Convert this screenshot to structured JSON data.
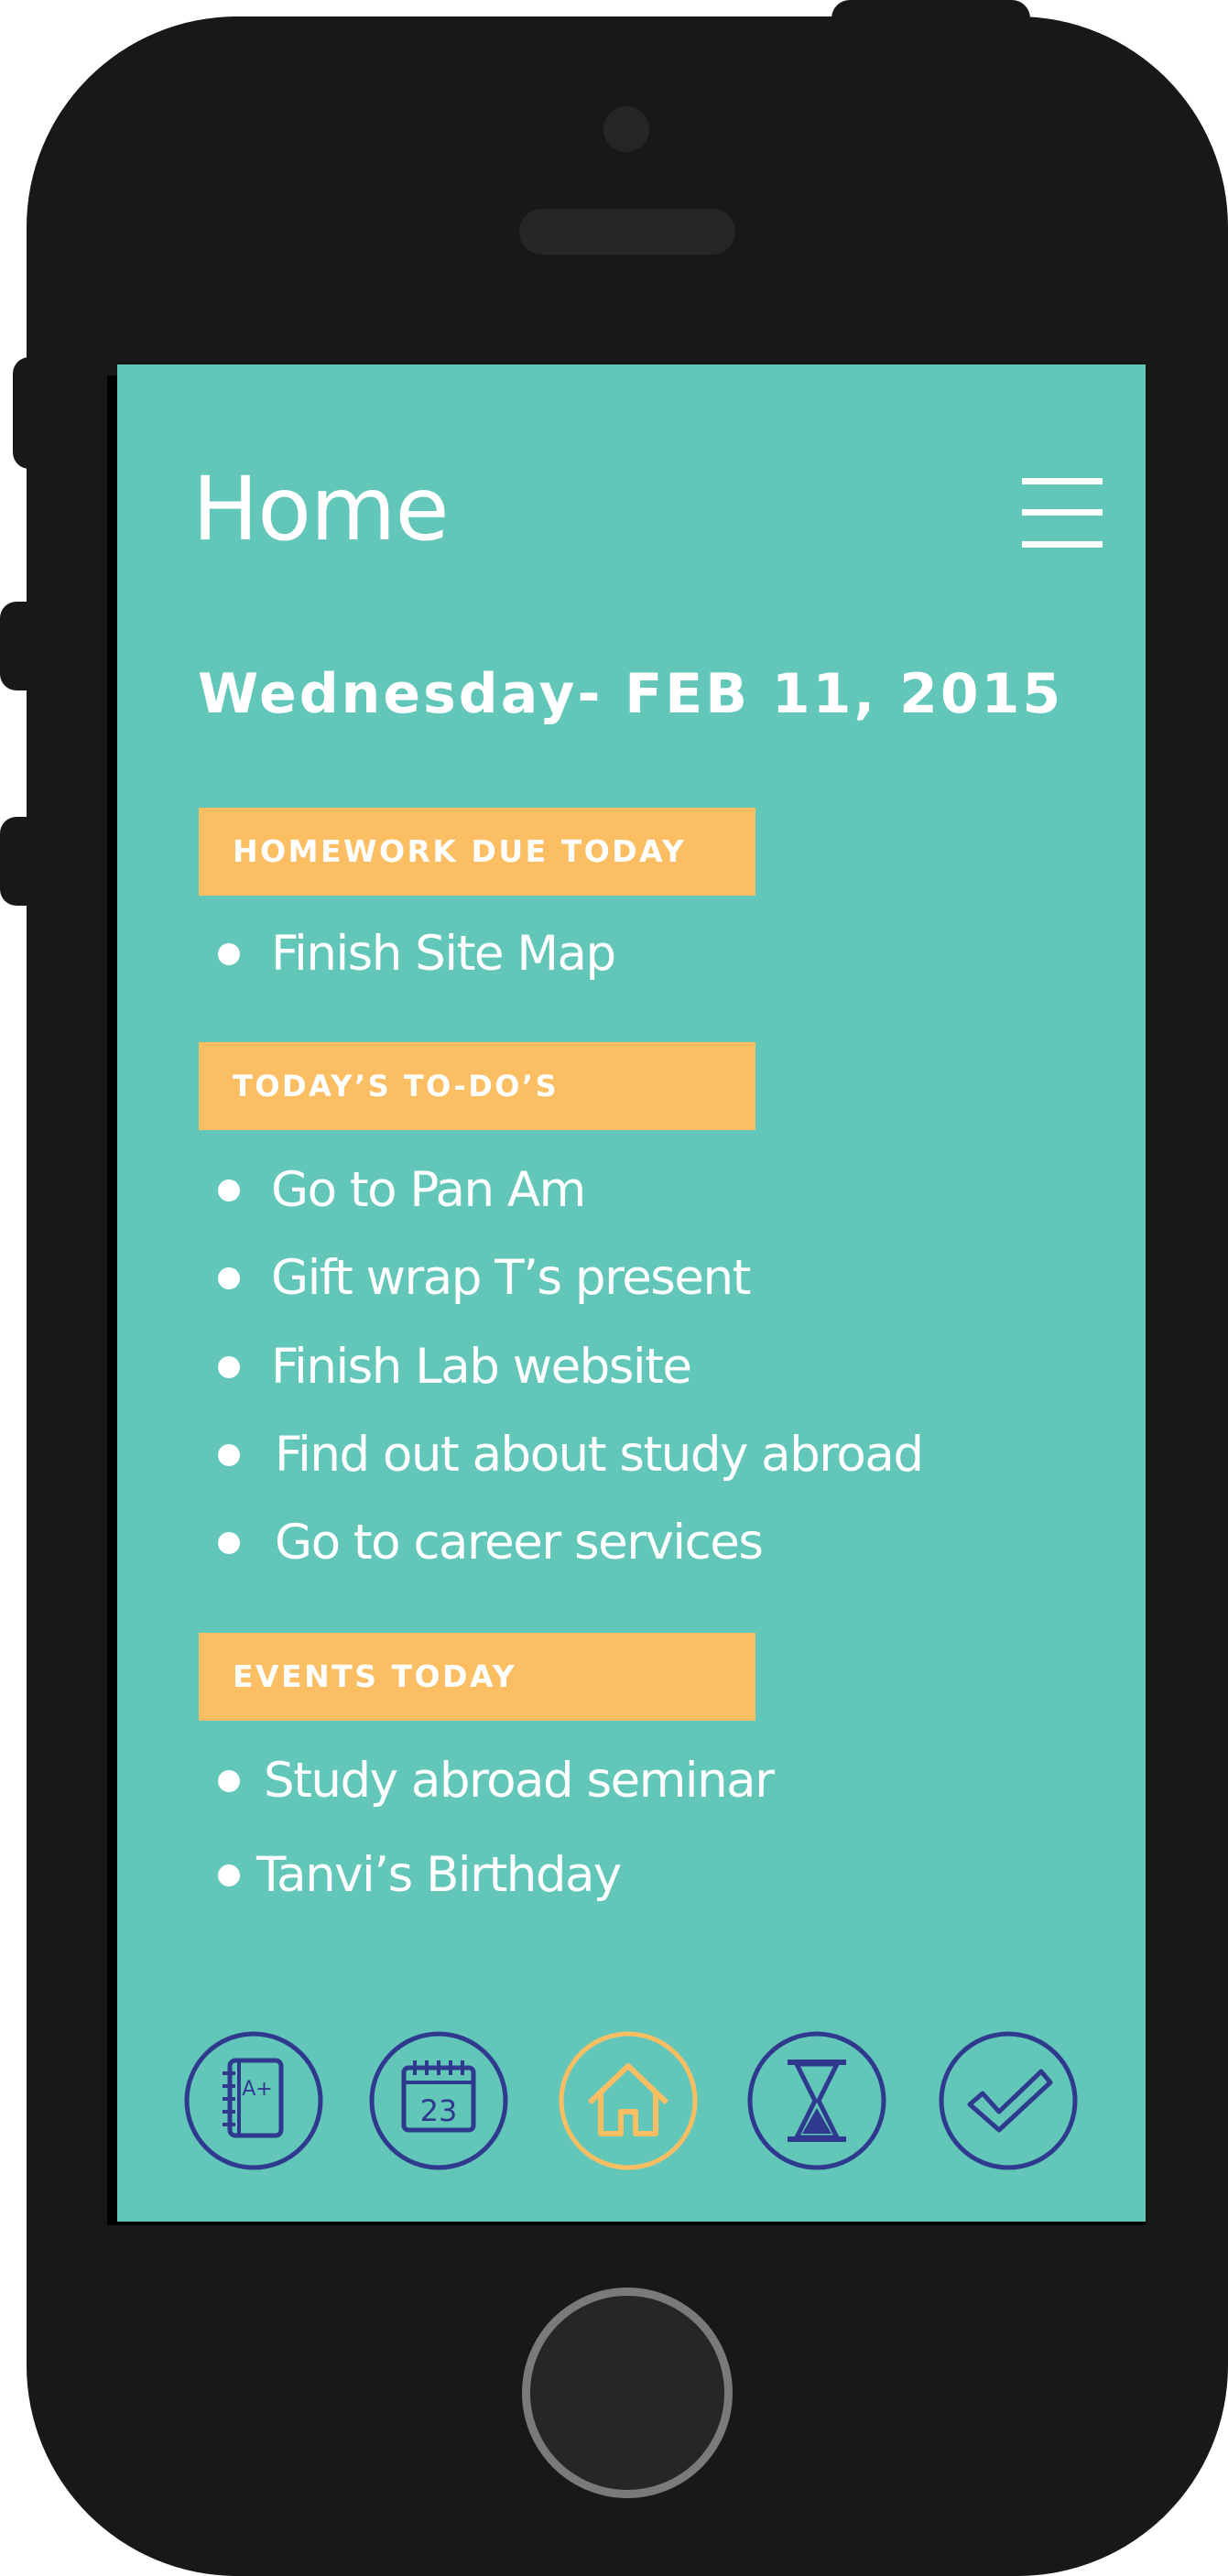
{
  "header": {
    "title": "Home",
    "menu_icon": "hamburger-icon"
  },
  "date": "Wednesday- FEB 11, 2015",
  "sections": [
    {
      "label": "HOMEWORK DUE TODAY",
      "items": [
        "Finish Site Map"
      ]
    },
    {
      "label": "TODAY’S TO-DO’S",
      "items": [
        "Go to Pan Am",
        "Gift wrap T’s present",
        "Finish Lab website",
        "Find out about study abroad",
        "Go to career services"
      ]
    },
    {
      "label": "EVENTS TODAY",
      "items": [
        "Study abroad seminar",
        "Tanvi’s Birthday"
      ]
    }
  ],
  "nav": {
    "items": [
      {
        "icon": "gradebook-icon",
        "badge": "A+",
        "active": false
      },
      {
        "icon": "calendar-icon",
        "badge": "23",
        "active": false
      },
      {
        "icon": "home-icon",
        "active": true
      },
      {
        "icon": "hourglass-icon",
        "active": false
      },
      {
        "icon": "checkmark-icon",
        "active": false
      }
    ]
  },
  "colors": {
    "screen_bg": "#62c6b9",
    "section_label_bg": "#fbbe62",
    "nav_icon": "#2f3a8f",
    "nav_icon_active": "#fbbe62",
    "text": "#ffffff",
    "device": "#181818"
  }
}
